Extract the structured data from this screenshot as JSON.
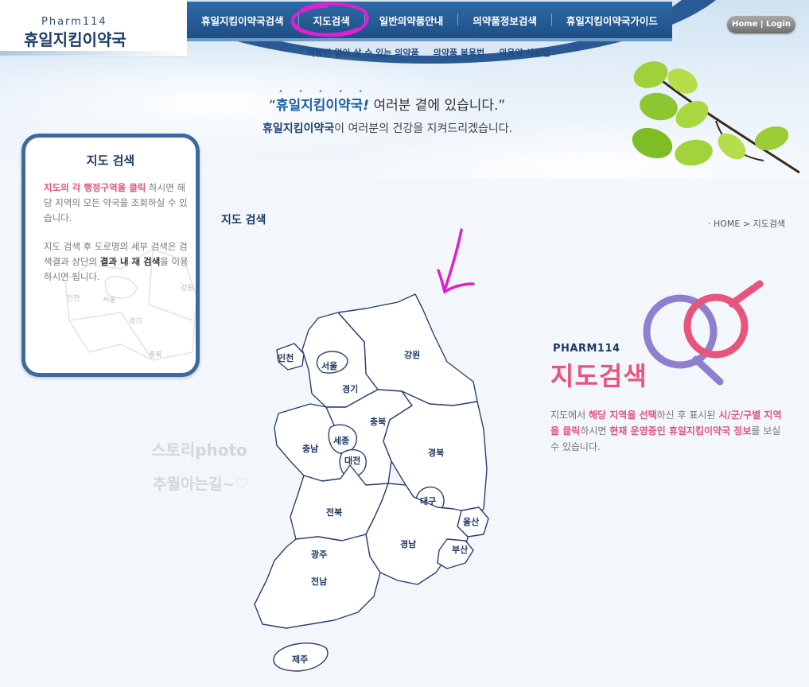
{
  "header": {
    "logo_top": "Pharm114",
    "logo_name": "휴일지킴이약국",
    "home_login": "Home | Login",
    "nav": [
      {
        "label": "휴일지킴이약국검색"
      },
      {
        "label": "지도검색"
      },
      {
        "label": "일반의약품안내"
      },
      {
        "label": "의약품정보검색"
      },
      {
        "label": "휴일지킴이약국가이드"
      }
    ],
    "subnav": [
      {
        "label": "처방전 없이 살 수 있는 의약품"
      },
      {
        "label": "의약품 복용법"
      },
      {
        "label": "외용약 사용법"
      }
    ],
    "slogan": {
      "dots": "• • • • •",
      "open_quote": "“",
      "brand": "휴일지킴이약국",
      "exclaim": "!",
      "rest": " 여러분 곁에 있습니다.”",
      "line2_brand": "휴일지킴이약국",
      "line2_rest": "이 여러분의 건강을 지켜드리겠습니다."
    }
  },
  "sidebar": {
    "title": "지도 검색",
    "p1_pink": "지도의 각 행정구역을 클릭",
    "p1_rest": " 하시면 해당 지역의 모든 약국을 조회하실 수 있습니다.",
    "p2_a": "지도 검색 후 도로명의 세부 검색은 검색결과 상단의 ",
    "p2_bold": "결과 내 재 검색",
    "p2_b": "을 이용하시면 됩니다.",
    "mini_labels": [
      "인천",
      "서울",
      "강원",
      "경기",
      "충북"
    ]
  },
  "content": {
    "title": "지도 검색",
    "breadcrumb": "·  HOME  >  지도검색",
    "watermark1": "스토리photo",
    "watermark2": "추월아는길~♡",
    "pharm_small": "PHARM114",
    "heading": "지도검색",
    "desc_a": "지도에서 ",
    "desc_pink1": "해당 지역을 선택",
    "desc_b": "하신 후 표시된 ",
    "desc_pink2": "시/군/구별 지역을 클릭",
    "desc_c": "하시면  ",
    "desc_pink3": "현재 운영중인 휴일지킴이약국 정보",
    "desc_d": "를 보실 수 있습니다."
  },
  "regions": [
    {
      "name": "인천"
    },
    {
      "name": "서울"
    },
    {
      "name": "경기"
    },
    {
      "name": "강원"
    },
    {
      "name": "충북"
    },
    {
      "name": "세종"
    },
    {
      "name": "충남"
    },
    {
      "name": "대전"
    },
    {
      "name": "경북"
    },
    {
      "name": "대구"
    },
    {
      "name": "전북"
    },
    {
      "name": "울산"
    },
    {
      "name": "경남"
    },
    {
      "name": "부산"
    },
    {
      "name": "광주"
    },
    {
      "name": "전남"
    },
    {
      "name": "제주"
    }
  ],
  "colors": {
    "nav_blue": "#1e4f86",
    "accent_pink": "#e8547c",
    "annotation_magenta": "#e020d0",
    "region_stroke": "#2b3f73"
  }
}
